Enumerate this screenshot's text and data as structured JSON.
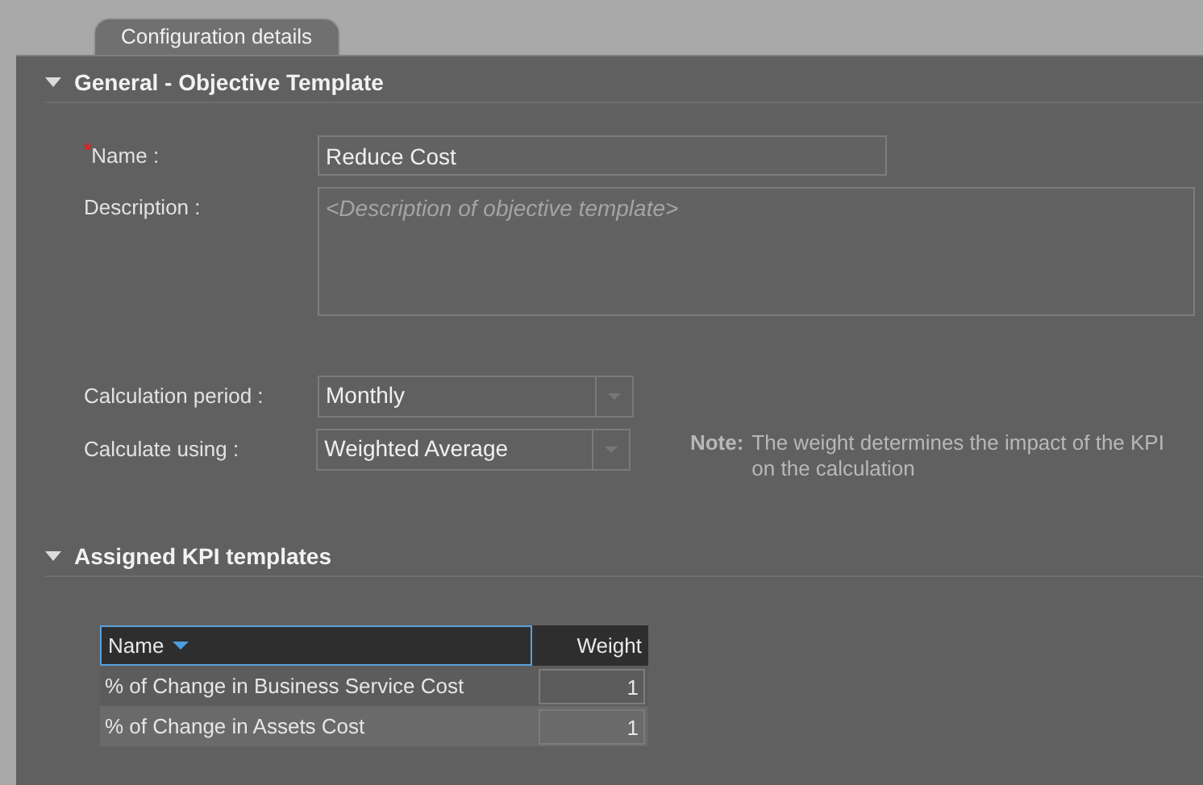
{
  "tabs": [
    {
      "label": "Configuration details",
      "selected": true
    }
  ],
  "sections": [
    {
      "title": "General - Objective Template",
      "expanded": true
    },
    {
      "title": "Assigned KPI templates",
      "expanded": true
    }
  ],
  "form": {
    "name": {
      "required_mark": "*",
      "label": "Name :",
      "value": "Reduce Cost"
    },
    "description": {
      "label": "Description :",
      "placeholder": "<Description of objective template>"
    },
    "calculation_period": {
      "label": "Calculation period :",
      "value": "Monthly"
    },
    "calculate_using": {
      "label": "Calculate using :",
      "value": "Weighted Average"
    },
    "note": {
      "label": "Note:",
      "text": "The weight determines the impact of the KPI on the calculation"
    }
  },
  "table": {
    "columns": [
      {
        "label": "Name",
        "focused": true
      },
      {
        "label": "Weight",
        "focused": false
      }
    ],
    "rows": [
      {
        "name": "% of Change in Business Service Cost",
        "weight": "1"
      },
      {
        "name": "% of Change in Assets Cost",
        "weight": "1"
      }
    ]
  }
}
